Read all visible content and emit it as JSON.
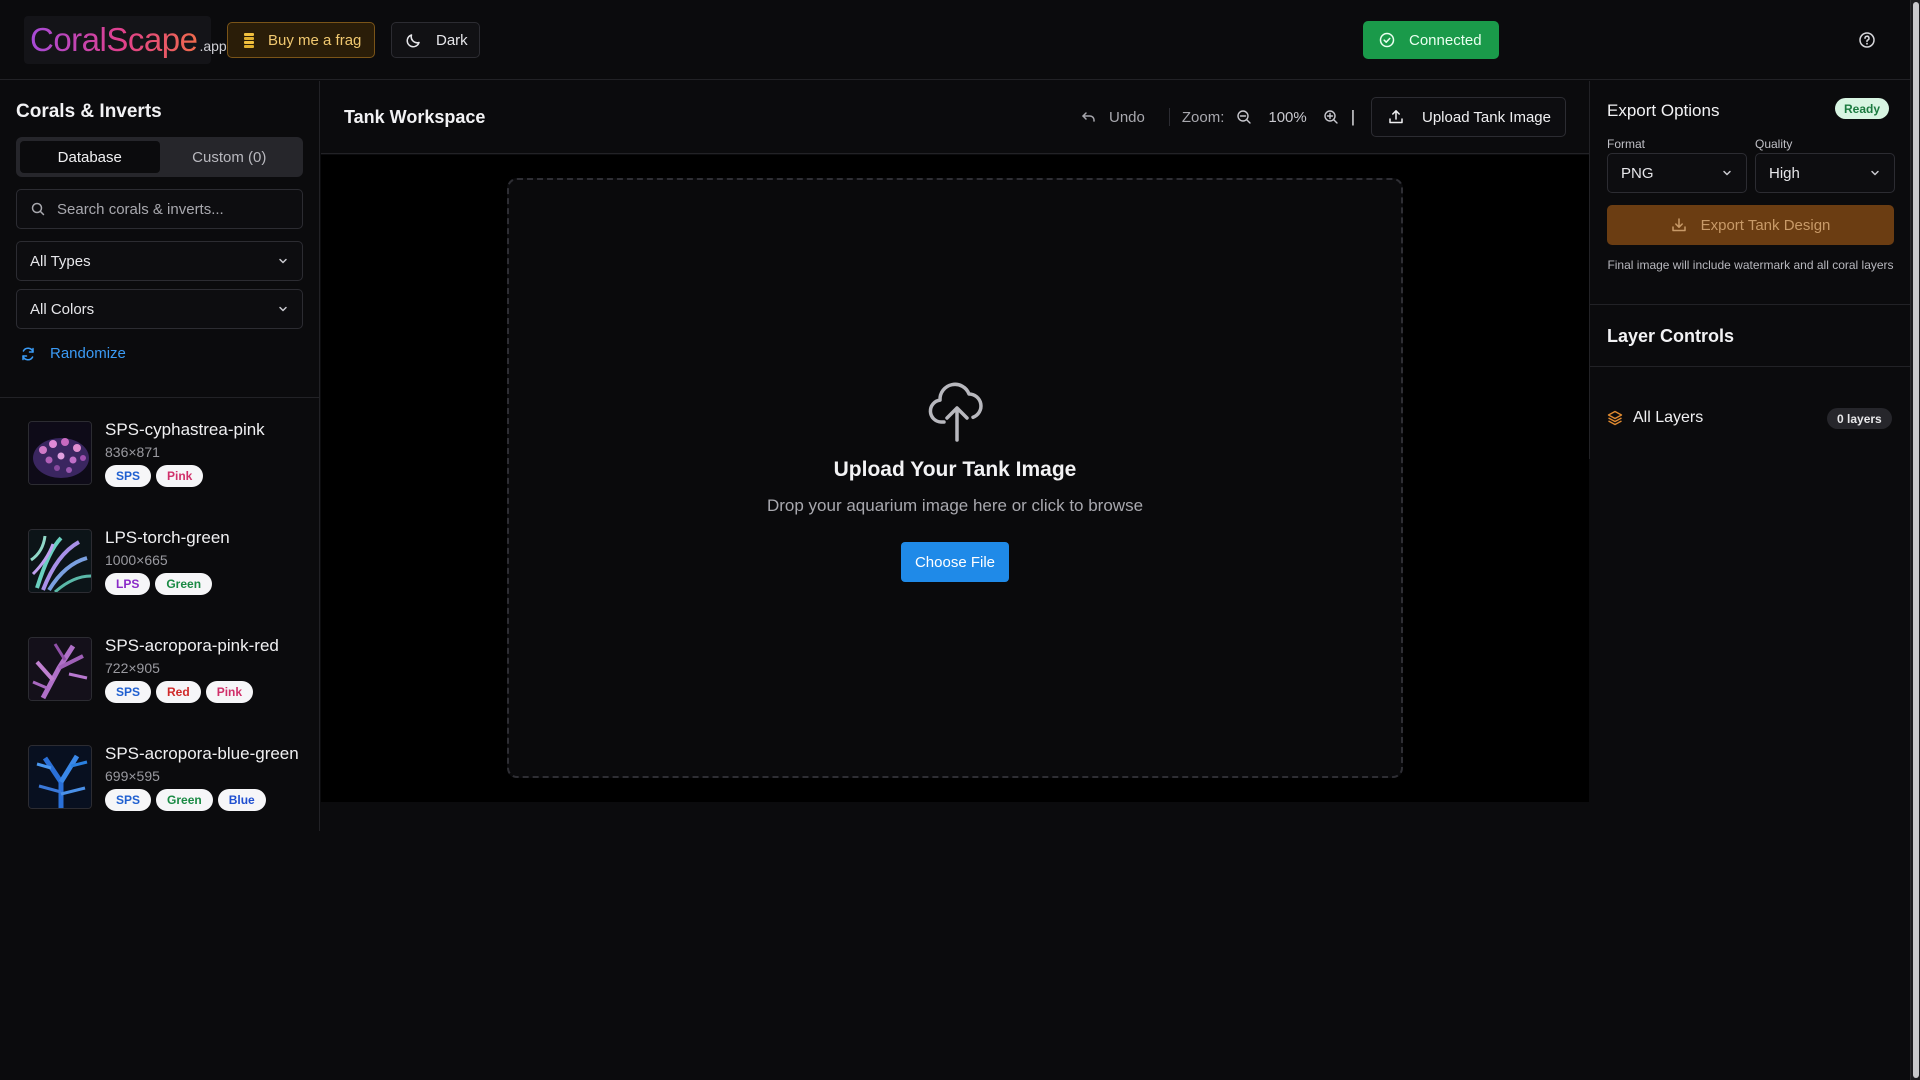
{
  "header": {
    "logo_main": "CoralScape",
    "logo_suffix": ".app",
    "frag_button": "Buy me a frag",
    "theme_button": "Dark",
    "status_button": "Connected",
    "accent_green": "#1a9a4a"
  },
  "sidebar": {
    "title": "Corals & Inverts",
    "tabs": [
      {
        "label": "Database",
        "active": true
      },
      {
        "label": "Custom (0)",
        "active": false
      }
    ],
    "search_placeholder": "Search corals & inverts...",
    "type_filter": "All Types",
    "color_filter": "All Colors",
    "randomize_label": "Randomize",
    "items": [
      {
        "name": "SPS-cyphastrea-pink",
        "dims": "836×871",
        "tags": [
          {
            "label": "SPS",
            "color": "#1f5fd0"
          },
          {
            "label": "Pink",
            "color": "#d0306a"
          }
        ]
      },
      {
        "name": "LPS-torch-green",
        "dims": "1000×665",
        "tags": [
          {
            "label": "LPS",
            "color": "#8a2ac8"
          },
          {
            "label": "Green",
            "color": "#1a8a44"
          }
        ]
      },
      {
        "name": "SPS-acropora-pink-red",
        "dims": "722×905",
        "tags": [
          {
            "label": "SPS",
            "color": "#1f5fd0"
          },
          {
            "label": "Red",
            "color": "#d02a2a"
          },
          {
            "label": "Pink",
            "color": "#d0306a"
          }
        ]
      },
      {
        "name": "SPS-acropora-blue-green",
        "dims": "699×595",
        "tags": [
          {
            "label": "SPS",
            "color": "#1f5fd0"
          },
          {
            "label": "Green",
            "color": "#1a8a44"
          },
          {
            "label": "Blue",
            "color": "#1f4fd0"
          }
        ]
      }
    ]
  },
  "workspace": {
    "title": "Tank Workspace",
    "undo_label": "Undo",
    "zoom_label": "Zoom:",
    "zoom_value": "100%",
    "divider_char": "|",
    "upload_button": "Upload Tank Image",
    "dropzone_title": "Upload Your Tank Image",
    "dropzone_subtitle": "Drop your aquarium image here or click to browse",
    "choose_button": "Choose File",
    "choose_color": "#1f8ae8"
  },
  "export": {
    "title": "Export Options",
    "status_badge": "Ready",
    "format_label": "Format",
    "format_value": "PNG",
    "quality_label": "Quality",
    "quality_value": "High",
    "export_button": "Export Tank Design",
    "note": "Final image will include watermark and all coral layers"
  },
  "layers": {
    "title": "Layer Controls",
    "all_layers_label": "All Layers",
    "count_badge": "0 layers"
  }
}
